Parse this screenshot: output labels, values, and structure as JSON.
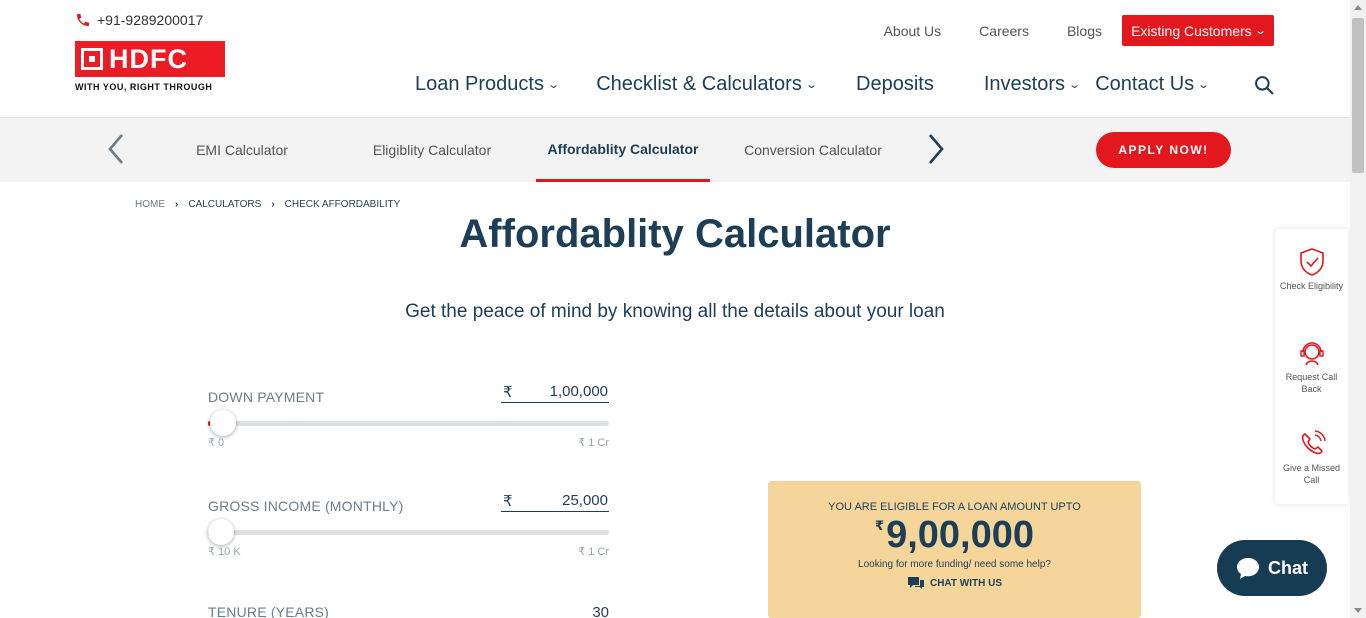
{
  "header": {
    "phone": "+91-9289200017",
    "logo_text": "HDFC",
    "logo_tagline": "WITH YOU, RIGHT THROUGH",
    "top_links": [
      "About Us",
      "Careers",
      "Blogs"
    ],
    "existing_customers": "Existing Customers",
    "nav": [
      {
        "label": "Loan Products",
        "has_dropdown": true
      },
      {
        "label": "Checklist & Calculators",
        "has_dropdown": true
      },
      {
        "label": "Deposits",
        "has_dropdown": false
      },
      {
        "label": "Investors",
        "has_dropdown": true
      },
      {
        "label": "Contact Us",
        "has_dropdown": true
      }
    ],
    "chevron": "⌄"
  },
  "calc_tabs": {
    "tabs": [
      "EMI Calculator",
      "Eligiblity Calculator",
      "Affordablity Calculator",
      "Conversion Calculator"
    ],
    "active": "Affordablity Calculator",
    "apply": "APPLY NOW!"
  },
  "breadcrumb": [
    "HOME",
    "CALCULATORS",
    "CHECK AFFORDABILITY"
  ],
  "page": {
    "title": "Affordablity Calculator",
    "subtitle": "Get the peace of mind by knowing all the details about your loan"
  },
  "fields": {
    "down_payment": {
      "label": "DOWN PAYMENT",
      "currency": "₹",
      "value": "1,00,000",
      "min": "₹ 0",
      "max": "₹ 1 Cr",
      "fraction": 0.01
    },
    "gross_income": {
      "label": "GROSS INCOME (MONTHLY)",
      "currency": "₹",
      "value": "25,000",
      "min": "₹ 10 K",
      "max": "₹ 1 Cr",
      "fraction": 0.0015
    },
    "tenure": {
      "label": "TENURE (YEARS)",
      "value": "30"
    }
  },
  "result": {
    "heading": "YOU ARE ELIGIBLE FOR A LOAN AMOUNT UPTO",
    "currency": "₹",
    "amount": "9,00,000",
    "help": "Looking for more funding/ need some help?",
    "chat": "CHAT WITH US"
  },
  "rail": [
    {
      "label": "Check Eligibility",
      "icon": "shield-check-icon"
    },
    {
      "label": "Request Call Back",
      "icon": "support-agent-icon"
    },
    {
      "label": "Give a Missed Call",
      "icon": "phone-ring-icon"
    }
  ],
  "chat_button": "Chat",
  "colors": {
    "brand_red": "#e3171e",
    "navy": "#1c3e57",
    "result_bg": "#f6d59b",
    "chat_bg": "#163c53"
  }
}
